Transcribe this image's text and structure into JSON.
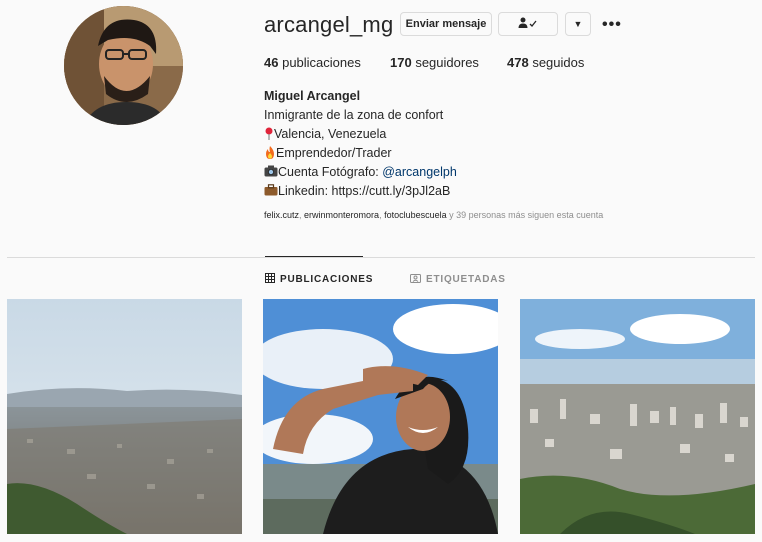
{
  "profile": {
    "username": "arcangel_mg",
    "message_button": "Enviar mensaje",
    "following_icon": "person-check-icon",
    "dropdown_icon": "chevron-down-icon",
    "more_icon": "more-icon",
    "more_label": "•••",
    "stats": {
      "posts_count": "46",
      "posts_label": "publicaciones",
      "followers_count": "170",
      "followers_label": "seguidores",
      "following_count": "478",
      "following_label": "seguidos"
    },
    "full_name": "Miguel Arcangel",
    "bio": {
      "line1": "Inmigrante de la zona de confort",
      "line2": "Valencia, Venezuela",
      "line3": "Emprendedor/Trader",
      "line4_prefix": "Cuenta Fotógrafo: ",
      "line4_link": "@arcangelph",
      "line5": "Linkedin: https://cutt.ly/3pJl2aB"
    },
    "followed_by": {
      "user1": "felix.cutz",
      "user2": "erwinmonteromora",
      "user3": "fotoclubescuela",
      "rest": " y 39 personas más siguen esta cuenta"
    }
  },
  "tabs": [
    {
      "label": "PUBLICACIONES",
      "icon": "grid-icon",
      "active": true
    },
    {
      "label": "ETIQUETADAS",
      "icon": "tag-icon",
      "active": false
    }
  ],
  "colors": {
    "background": "#fafafa",
    "text": "#262626",
    "muted": "#8e8e8e",
    "link": "#00376b",
    "border": "#dbdbdb"
  }
}
